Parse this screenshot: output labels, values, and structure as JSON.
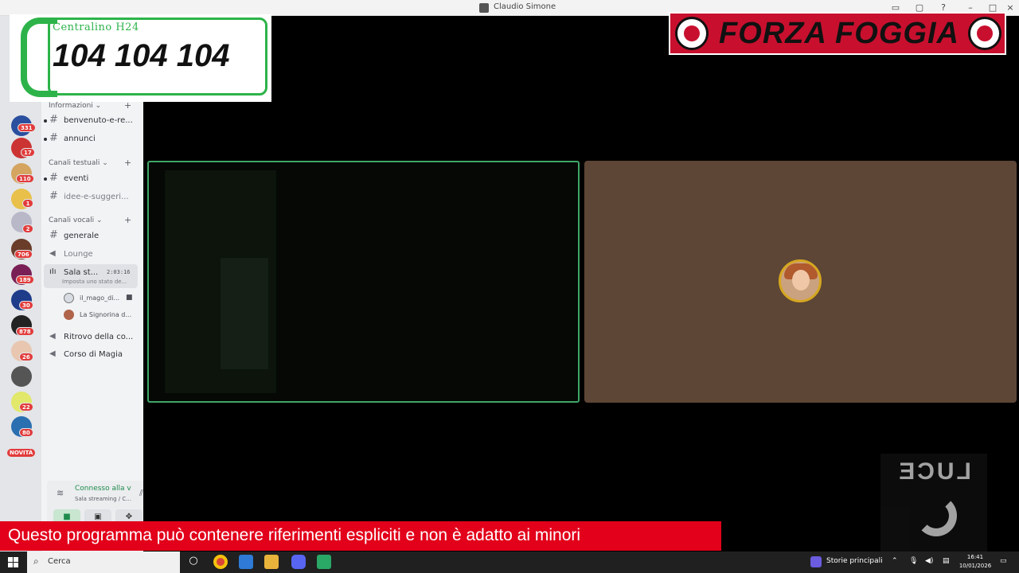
{
  "window": {
    "title": "Claudio Simone"
  },
  "servers": {
    "badges": [
      "331",
      "17",
      "110",
      "1",
      "2",
      "706",
      "189",
      "30",
      "878",
      "26",
      "22",
      "80"
    ],
    "novita_label": "NOVITÀ"
  },
  "channels": {
    "categories": {
      "info": "Informazioni ⌄",
      "text": "Canali testuali ⌄",
      "voice": "Canali vocali ⌄"
    },
    "items": {
      "benvenuto": "benvenuto-e-re...",
      "annunci": "annunci",
      "eventi": "eventi",
      "idee": "idee-e-suggeri...",
      "generale": "generale",
      "lounge": "Lounge",
      "sala": "Sala st...",
      "sala_time": "2:03:16",
      "sala_status": "Imposta uno stato de...",
      "ritrovo": "Ritrovo della co...",
      "corso": "Corso di Magia"
    },
    "participants": [
      "il_mago_di...",
      "La Signorina d..."
    ]
  },
  "voice_panel": {
    "status": "Connesso alla v",
    "location": "Sala streaming / C..."
  },
  "overlays": {
    "phone_label": "Centralino H24",
    "phone_number": "104 104 104",
    "forza": "FORZA FOGGIA",
    "luce": "LUCE",
    "warning": "Questo programma  può contenere riferimenti espliciti e non è adatto ai minori"
  },
  "taskbar": {
    "search": "Cerca",
    "news": "Storie principali",
    "time": "16:41",
    "date": "10/01/2026"
  },
  "colors": {
    "speaking_border": "#3fa566",
    "warning_bar": "#e2001a",
    "forza_red": "#c8102e",
    "phone_green": "#2db34a"
  }
}
